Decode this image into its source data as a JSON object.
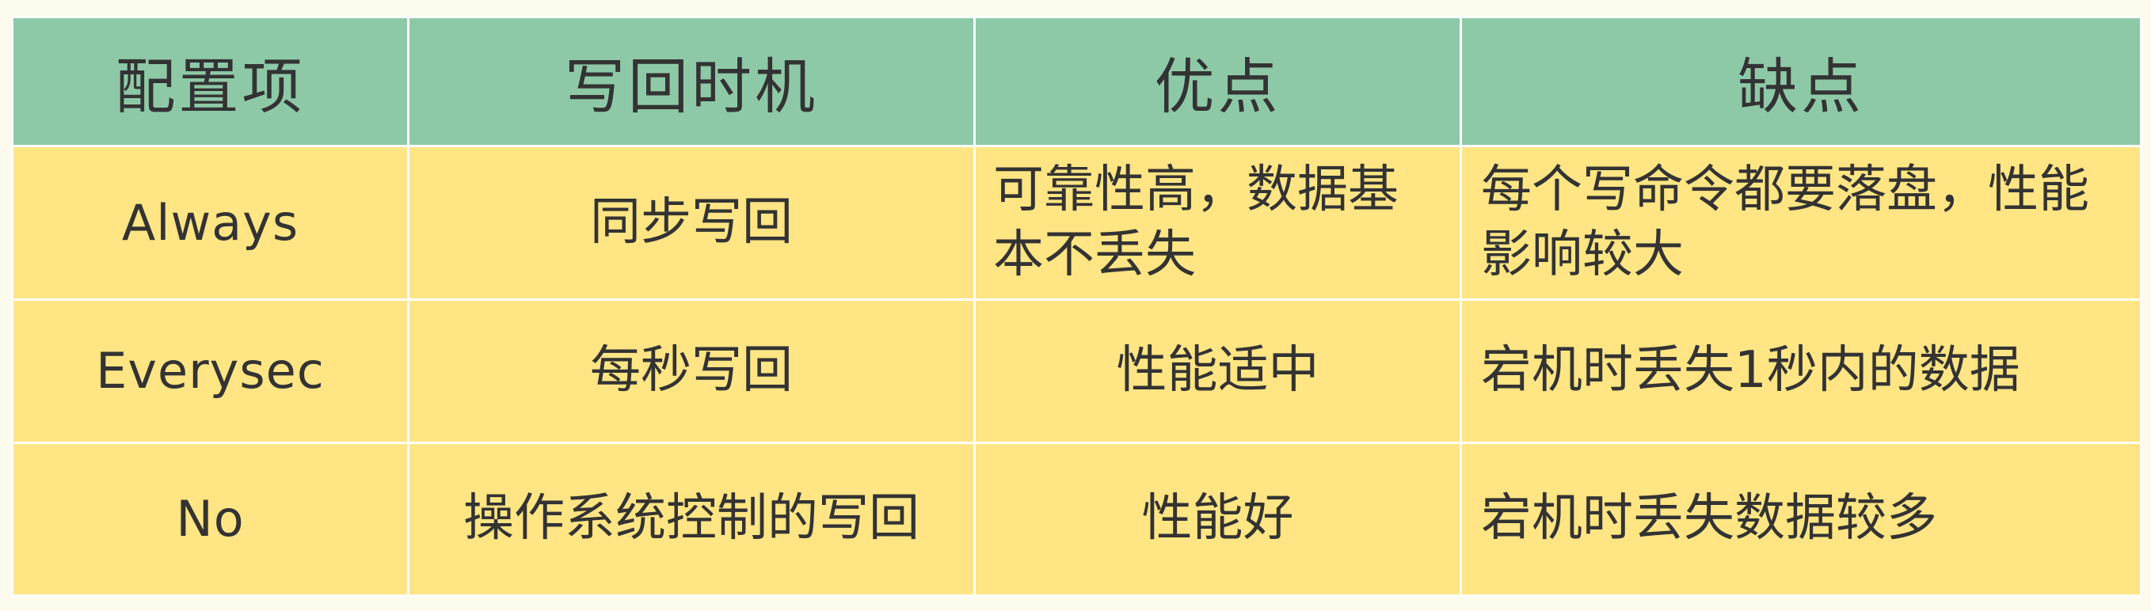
{
  "table": {
    "headers": [
      "配置项",
      "写回时机",
      "优点",
      "缺点"
    ],
    "rows": [
      {
        "config": "Always",
        "timing": "同步写回",
        "pros": "可靠性高，数据基本不丢失",
        "cons": "每个写命令都要落盘，性能影响较大"
      },
      {
        "config": "Everysec",
        "timing": "每秒写回",
        "pros": "性能适中",
        "cons": "宕机时丢失1秒内的数据"
      },
      {
        "config": "No",
        "timing": "操作系统控制的写回",
        "pros": "性能好",
        "cons": "宕机时丢失数据较多"
      }
    ]
  },
  "colors": {
    "header_bg": "#8ec9a7",
    "body_bg": "#ffe584",
    "border": "#ffffff",
    "text": "#333333",
    "page_bg": "#fdfbee"
  }
}
